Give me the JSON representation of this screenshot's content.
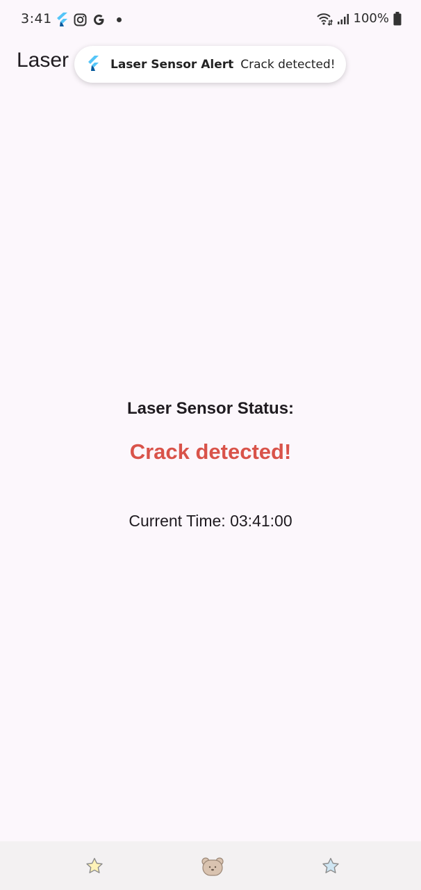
{
  "status_bar": {
    "time": "3:41",
    "battery": "100%",
    "left_icons": [
      "flutter-icon",
      "instagram-icon",
      "google-icon",
      "notification-dot"
    ],
    "right_icons": [
      "wifi-icon",
      "signal-icon",
      "battery-icon"
    ]
  },
  "app_bar": {
    "title": "Laser"
  },
  "notification": {
    "icon": "flutter-icon",
    "title": "Laser Sensor Alert",
    "body": "Crack detected!"
  },
  "main": {
    "status_label": "Laser Sensor Status:",
    "status_value": "Crack detected!",
    "current_time": "Current Time: 03:41:00"
  },
  "bottom_nav": {
    "items": [
      {
        "icon": "star-yellow-icon"
      },
      {
        "icon": "bear-icon"
      },
      {
        "icon": "star-blue-icon"
      }
    ]
  },
  "colors": {
    "background": "#fcf7fc",
    "alert": "#d9534a",
    "nav_background": "#f3f1f2"
  }
}
